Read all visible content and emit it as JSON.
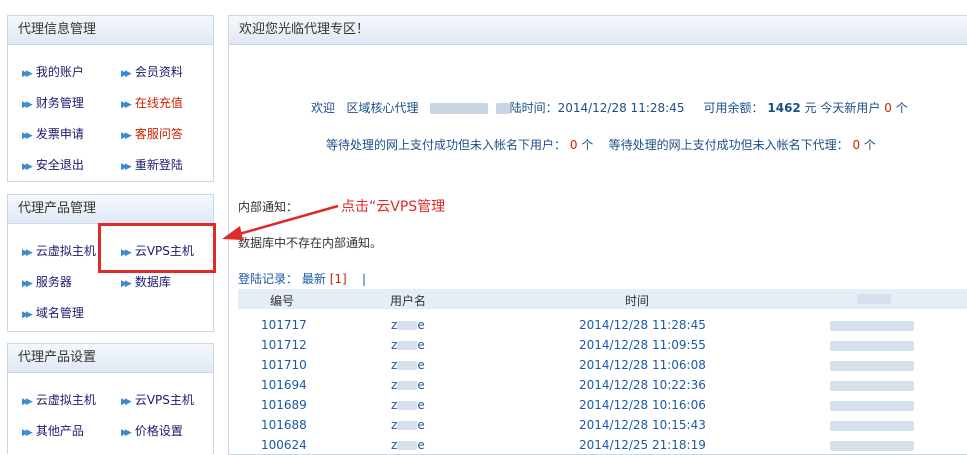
{
  "sidebar": {
    "info_title": "代理信息管理",
    "info_items": [
      {
        "label": "我的账户"
      },
      {
        "label": "会员资料"
      },
      {
        "label": "财务管理"
      },
      {
        "label": "在线充值"
      },
      {
        "label": "发票申请"
      },
      {
        "label": "客服问答"
      },
      {
        "label": "安全退出"
      },
      {
        "label": "重新登陆"
      }
    ],
    "product_title": "代理产品管理",
    "product_items": [
      {
        "label": "云虚拟主机"
      },
      {
        "label": "云VPS主机"
      },
      {
        "label": "服务器"
      },
      {
        "label": "数据库"
      },
      {
        "label": "域名管理"
      }
    ],
    "settings_title": "代理产品设置",
    "settings_items": [
      {
        "label": "云虚拟主机"
      },
      {
        "label": "云VPS主机"
      },
      {
        "label": "其他产品"
      },
      {
        "label": "价格设置"
      }
    ]
  },
  "main": {
    "header": "欢迎您光临代理专区！",
    "welcome_prefix": "欢迎",
    "agent_level": "区域核心代理",
    "login_time_label": "陆时间：2014/12/28 11:28:45",
    "balance_label": "可用余额：",
    "balance_value": "1462",
    "balance_unit": "元 今天新用户",
    "new_users": "0",
    "new_users_unit": "个",
    "pending_users_label": "等待处理的网上支付成功但未入帐名下用户：",
    "pending_users_value": "0",
    "pending_users_unit": "个",
    "pending_agents_label": "等待处理的网上支付成功但未入帐名下代理：",
    "pending_agents_value": "0",
    "pending_agents_unit": "个",
    "notice_label": "内部通知：",
    "notice_empty": "数据库中不存在内部通知。",
    "login_log_label": "登陆记录：",
    "login_log_latest": "最新",
    "login_log_count": "[1]",
    "login_log_sep": "|",
    "table": {
      "headers": [
        "编号",
        "用户名",
        "时间"
      ],
      "rows": [
        {
          "id": "101717",
          "user_start": "z",
          "user_end": "e",
          "time": "2014/12/28 11:28:45"
        },
        {
          "id": "101712",
          "user_start": "z",
          "user_end": "e",
          "time": "2014/12/28 11:09:55"
        },
        {
          "id": "101710",
          "user_start": "z",
          "user_end": "e",
          "time": "2014/12/28 11:06:08"
        },
        {
          "id": "101694",
          "user_start": "z",
          "user_end": "e",
          "time": "2014/12/28 10:22:36"
        },
        {
          "id": "101689",
          "user_start": "z",
          "user_end": "e",
          "time": "2014/12/28 10:16:06"
        },
        {
          "id": "101688",
          "user_start": "z",
          "user_end": "e",
          "time": "2014/12/28 10:15:43"
        },
        {
          "id": "100624",
          "user_start": "z",
          "user_end": "e",
          "time": "2014/12/25 21:18:19"
        }
      ]
    }
  },
  "annotation": {
    "text": "点击“云VPS管理",
    "color": "#e02a2a"
  },
  "colors": {
    "accent_red": "#cc2200",
    "link_blue": "#1a5aa8",
    "panel_border": "#c9d7e6"
  }
}
